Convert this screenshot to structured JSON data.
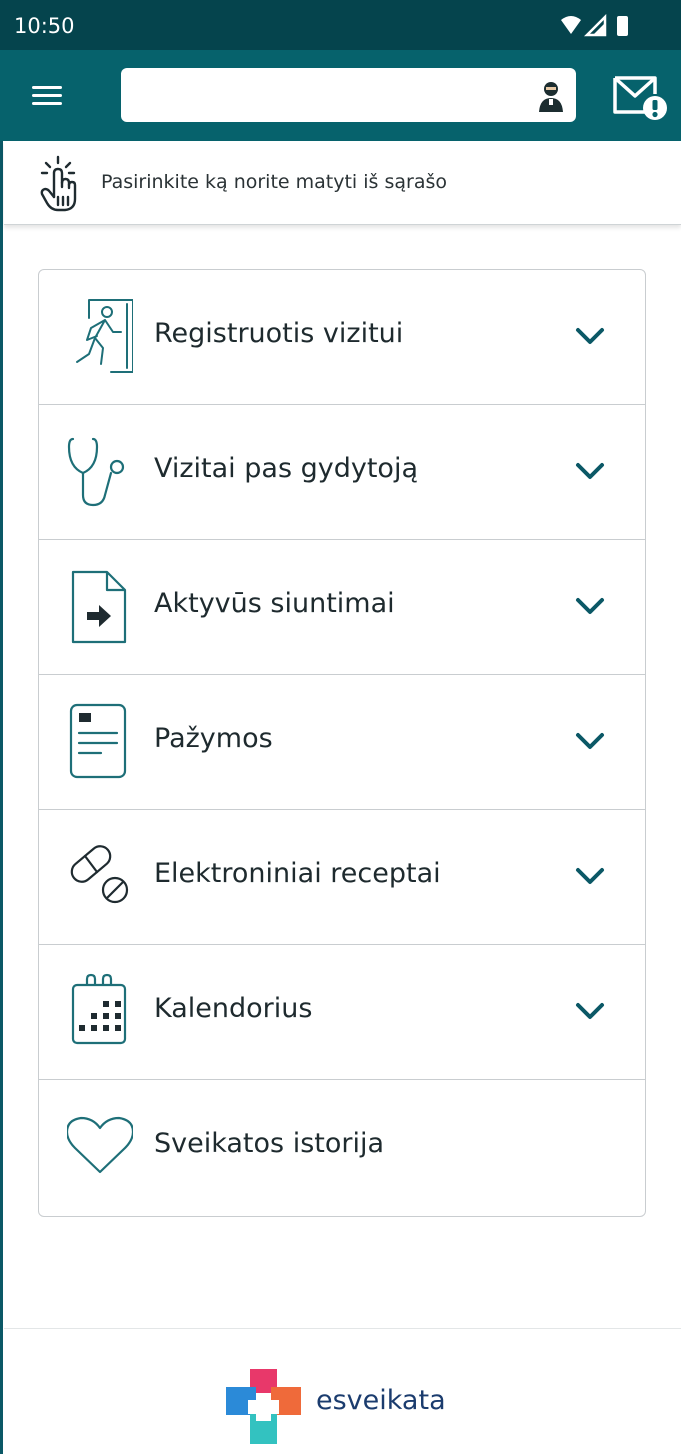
{
  "status_bar": {
    "time": "10:50"
  },
  "app_bar": {
    "search": {
      "value": "",
      "placeholder": ""
    }
  },
  "hint": {
    "text": "Pasirinkite ką norite matyti iš sąrašo"
  },
  "menu": {
    "items": [
      {
        "label": "Registruotis vizitui",
        "icon": "walking-person-door-icon",
        "expandable": true
      },
      {
        "label": "Vizitai pas gydytoją",
        "icon": "stethoscope-icon",
        "expandable": true
      },
      {
        "label": "Aktyvūs siuntimai",
        "icon": "referral-document-icon",
        "expandable": true
      },
      {
        "label": "Pažymos",
        "icon": "certificate-document-icon",
        "expandable": true
      },
      {
        "label": "Elektroniniai receptai",
        "icon": "pills-icon",
        "expandable": true
      },
      {
        "label": "Kalendorius",
        "icon": "calendar-icon",
        "expandable": true
      },
      {
        "label": "Sveikatos istorija",
        "icon": "heart-icon",
        "expandable": false
      }
    ]
  },
  "footer": {
    "logo_text": "esveikata"
  },
  "colors": {
    "status_bar": "#05444d",
    "app_bar": "#06626c",
    "accent": "#0b5866",
    "icon_stroke": "#1e6f78",
    "logo_text": "#1b3c6e"
  }
}
